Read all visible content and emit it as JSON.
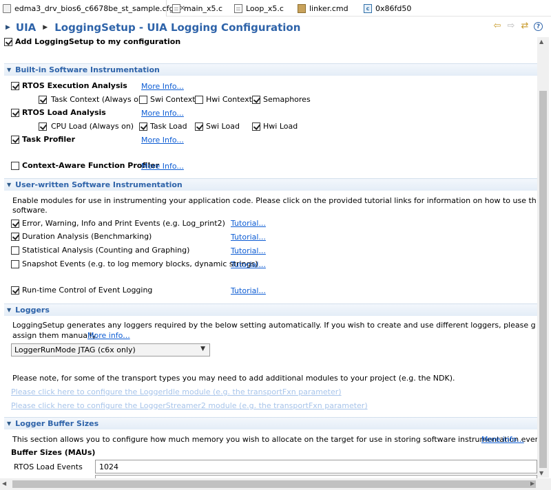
{
  "tabs": [
    {
      "label": "edma3_drv_bios6_c6678be_st_sample.cfg",
      "icon": "config-file-icon",
      "close": "✕",
      "active": true
    },
    {
      "label": "main_x5.c",
      "icon": "c-file-icon",
      "active": false
    },
    {
      "label": "Loop_x5.c",
      "icon": "c-file-icon",
      "active": false
    },
    {
      "label": "linker.cmd",
      "icon": "cmd-file-icon",
      "active": false
    },
    {
      "label": "0x86fd50",
      "icon": "disassembly-icon",
      "active": false
    }
  ],
  "header": {
    "uia": "UIA",
    "title": "LoggingSetup - UIA Logging Configuration",
    "tools": [
      "back-icon",
      "forward-icon",
      "refresh-icon",
      "help-icon"
    ]
  },
  "add_module": {
    "label": "Add LoggingSetup to my configuration",
    "checked": true
  },
  "builtin": {
    "title": "Built-in Software Instrumentation",
    "rtos_exec": {
      "label": "RTOS Execution Analysis",
      "checked": true,
      "more": "More Info..."
    },
    "task_context": {
      "label": "Task Context (Always on)",
      "checked": true
    },
    "swi_context": {
      "label": "Swi Context",
      "checked": false
    },
    "hwi_context": {
      "label": "Hwi Context",
      "checked": false
    },
    "semaphores": {
      "label": "Semaphores",
      "checked": true
    },
    "rtos_load": {
      "label": "RTOS Load Analysis",
      "checked": true,
      "more": "More Info..."
    },
    "cpu_load": {
      "label": "CPU  Load  (Always on)",
      "checked": true
    },
    "task_load": {
      "label": "Task Load",
      "checked": true
    },
    "swi_load": {
      "label": "Swi Load",
      "checked": true
    },
    "hwi_load": {
      "label": "Hwi Load",
      "checked": true
    },
    "task_profiler": {
      "label": "Task Profiler",
      "checked": true,
      "more": "More Info..."
    },
    "context_profiler": {
      "label": "Context-Aware Function Profiler",
      "checked": false,
      "more": "More Info..."
    }
  },
  "userwritten": {
    "title": "User-written Software Instrumentation",
    "description_line1": "Enable modules for use in instrumenting your application code. Please click on the provided tutorial links for information on how to use these modules to instru",
    "description_line2": "software.",
    "items": [
      {
        "label": "Error, Warning, Info and Print Events (e.g. Log_print2)",
        "checked": true,
        "link": "Tutorial..."
      },
      {
        "label": "Duration Analysis (Benchmarking)",
        "checked": true,
        "link": "Tutorial..."
      },
      {
        "label": "Statistical Analysis (Counting and Graphing)",
        "checked": false,
        "link": "Tutorial..."
      },
      {
        "label": "Snapshot Events (e.g. to log memory blocks, dynamic strings)",
        "checked": false,
        "link": "Tutorial..."
      },
      {
        "label": "Run-time Control of Event Logging",
        "checked": true,
        "link": "Tutorial..."
      }
    ]
  },
  "loggers": {
    "title": "Loggers",
    "description_line1": "LoggingSetup generates any loggers required by the below setting automatically. If you wish to create and use different loggers, please go to the \"Advanced\" ta",
    "description_line2": "assign them manually.",
    "more": "More info...",
    "selected": "LoggerRunMode JTAG (c6x only)",
    "note": "Please note, for some of the transport types you may need to add additional modules to your project (e.g. the NDK).",
    "link_idle": "Please click here to configure the LoggerIdle module (e.g. the transportFxn parameter)",
    "link_streamer": "Please click here to configure the LoggerStreamer2 module (e.g. the transportFxn parameter)"
  },
  "buffers": {
    "title": "Logger Buffer Sizes",
    "description": "This section allows you to configure how much memory you wish to allocate on the target for use in storing software instrumentation events.",
    "more": "More info...",
    "subtitle": "Buffer Sizes (MAUs)",
    "rtos_load_label": "RTOS Load Events",
    "rtos_load_value": "1024"
  }
}
